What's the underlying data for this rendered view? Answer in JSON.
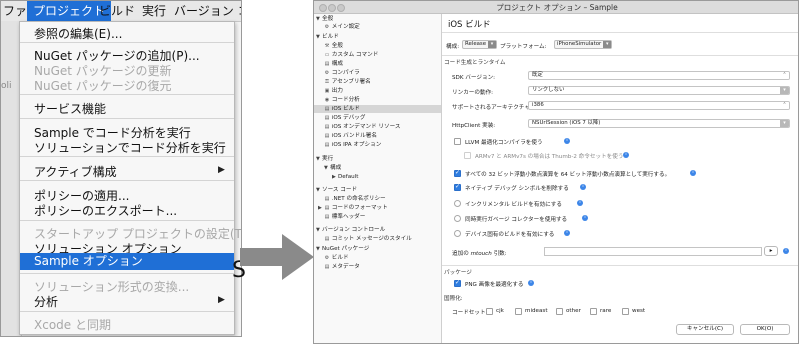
{
  "menu": {
    "menubar": [
      "ファイル",
      "プロジェクト",
      "ビルド",
      "実行",
      "バージョン コントロール"
    ],
    "behind_text": "oli",
    "items": [
      {
        "label": "参照の編集(E)...",
        "state": "normal"
      },
      {
        "label": "NuGet パッケージの追加(P)...",
        "state": "normal"
      },
      {
        "label": "NuGet パッケージの更新",
        "state": "disabled"
      },
      {
        "label": "NuGet パッケージの復元",
        "state": "disabled"
      },
      {
        "label": "サービス機能",
        "state": "normal"
      },
      {
        "label": "Sample でコード分析を実行",
        "state": "normal"
      },
      {
        "label": "ソリューションでコード分析を実行",
        "state": "normal"
      },
      {
        "label": "アクティブ構成",
        "state": "submenu"
      },
      {
        "label": "ポリシーの適用...",
        "state": "normal"
      },
      {
        "label": "ポリシーのエクスポート...",
        "state": "normal"
      },
      {
        "label": "スタートアップ プロジェクトの設定(T)...",
        "state": "disabled"
      },
      {
        "label": "ソリューション オプション",
        "state": "normal"
      },
      {
        "label": "Sample オプション",
        "state": "selected"
      },
      {
        "label": "ソリューション形式の変換...",
        "state": "disabled"
      },
      {
        "label": "分析",
        "state": "submenu"
      },
      {
        "label": "Xcode と同期",
        "state": "disabled"
      }
    ],
    "submenu_arrow": "▶",
    "cut_letter": "S"
  },
  "colors": {
    "accent": "#1f6fd6",
    "check_blue": "#2f7de0",
    "arrow_gray": "#8a8a8a"
  },
  "dialog": {
    "title": "プロジェクト オプション – Sample",
    "sidebar": [
      {
        "label": "全般",
        "tri": "▼"
      },
      {
        "label": "メイン設定",
        "icon": "gear-icon"
      },
      {
        "label": "ビルド",
        "tri": "▼"
      },
      {
        "label": "全般",
        "icon": "tools-icon"
      },
      {
        "label": "カスタム コマンド",
        "icon": "terminal-icon"
      },
      {
        "label": "構成",
        "icon": "page-icon"
      },
      {
        "label": "コンパイラ",
        "icon": "gear-icon"
      },
      {
        "label": "アセンブリ署名",
        "icon": "key-icon"
      },
      {
        "label": "出力",
        "icon": "output-icon"
      },
      {
        "label": "コード分析",
        "icon": "analysis-icon"
      },
      {
        "label": "iOS ビルド",
        "icon": "page-icon",
        "selected": true
      },
      {
        "label": "iOS デバッグ",
        "icon": "page-icon"
      },
      {
        "label": "iOS オンデマンド リソース",
        "icon": "page-icon"
      },
      {
        "label": "iOS バンドル署名",
        "icon": "page-icon"
      },
      {
        "label": "iOS IPA オプション",
        "icon": "page-icon"
      },
      {
        "label": "実行",
        "tri": "▼"
      },
      {
        "label": "構成",
        "tri": "▼"
      },
      {
        "label": "Default",
        "tri": "▶"
      },
      {
        "label": "ソース コード",
        "tri": "▼"
      },
      {
        "label": ".NET の命名ポリシー",
        "icon": "page-icon"
      },
      {
        "label": "コードのフォーマット",
        "tri": "▶"
      },
      {
        "label": "標準ヘッダー",
        "icon": "page-icon"
      },
      {
        "label": "バージョン コントロール",
        "tri": "▼"
      },
      {
        "label": "コミット メッセージのスタイル",
        "icon": "page-icon"
      },
      {
        "label": "NuGet パッケージ",
        "tri": "▼"
      },
      {
        "label": "ビルド",
        "icon": "gear-icon"
      },
      {
        "label": "メタデータ",
        "icon": "page-icon"
      }
    ],
    "content_title": "iOS ビルド",
    "config_label": "構成:",
    "config_value": "Release",
    "platform_label": "プラットフォーム:",
    "platform_value": "iPhoneSimulator",
    "section_codegen": "コード生成とランタイム",
    "sdk_label": "SDK バージョン:",
    "sdk_value": "既定",
    "linker_label": "リンカーの動作:",
    "linker_value": "リンクしない",
    "arch_label": "サポートされるアーキテクチャ:",
    "arch_value": "i386",
    "http_label": "HttpClient 実装:",
    "http_value": "NSUrlSession (iOS 7 以降)",
    "llvm_label": "LLVM 最適化コンパイラを使う",
    "armv7_label": "ARMv7 と ARMv7s の場合は Thumb-2 命令セットを使う",
    "float_label": "すべての 32 ビット浮動小数点演算を 64 ビット浮動小数点演算として実行する。",
    "native_debug_label": "ネイティブ デバッグ シンボルを削除する",
    "incremental_label": "インクリメンタル ビルドを有効にする",
    "gc_label": "同時実行ガベージ コレクターを使用する",
    "device_build_label": "デバイス固有のビルドを有効にする",
    "mtouch_label_prefix": "追加の ",
    "mtouch_label_em": "mtouch",
    "mtouch_label_suffix": " 引数:",
    "mtouch_button": "▸",
    "packaging_label": "パッケージ",
    "png_label": "PNG 画像を最適化する",
    "i18n_label": "国際化:",
    "codesets_label": "コードセット:",
    "codesets": [
      "cjk",
      "mideast",
      "other",
      "rare",
      "west"
    ],
    "cancel_button": "キャンセル(C)",
    "ok_button": "OK(O)",
    "info_glyph": "i",
    "dropdown_glyph": "▾",
    "combo_glyph": "⌃"
  }
}
